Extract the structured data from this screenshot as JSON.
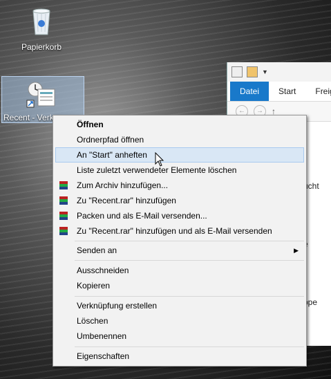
{
  "desktop": {
    "recycle_bin_label": "Papierkorb",
    "recent_shortcut_label": "Recent - Verkn"
  },
  "explorer": {
    "tabs": [
      "Datei",
      "Start",
      "Freig"
    ],
    "visible_fragments": [
      "ucht",
      "e",
      "ppe"
    ]
  },
  "context_menu": {
    "items": [
      {
        "label": "Öffnen",
        "bold": true
      },
      {
        "label": "Ordnerpfad öffnen"
      },
      {
        "label": "An \"Start\" anheften",
        "highlighted": true
      },
      {
        "label": "Liste zuletzt verwendeter Elemente löschen"
      },
      {
        "label": "Zum Archiv hinzufügen...",
        "icon": "winrar-icon"
      },
      {
        "label": "Zu \"Recent.rar\" hinzufügen",
        "icon": "winrar-icon"
      },
      {
        "label": "Packen und als E-Mail versenden...",
        "icon": "winrar-icon"
      },
      {
        "label": "Zu \"Recent.rar\" hinzufügen und als E-Mail versenden",
        "icon": "winrar-icon"
      },
      {
        "label": "Senden an",
        "submenu": true
      },
      {
        "label": "Ausschneiden"
      },
      {
        "label": "Kopieren"
      },
      {
        "label": "Verknüpfung erstellen"
      },
      {
        "label": "Löschen"
      },
      {
        "label": "Umbenennen"
      },
      {
        "label": "Eigenschaften"
      }
    ]
  },
  "colors": {
    "highlight": "#d9e7f5",
    "file_tab": "#1979ca"
  }
}
